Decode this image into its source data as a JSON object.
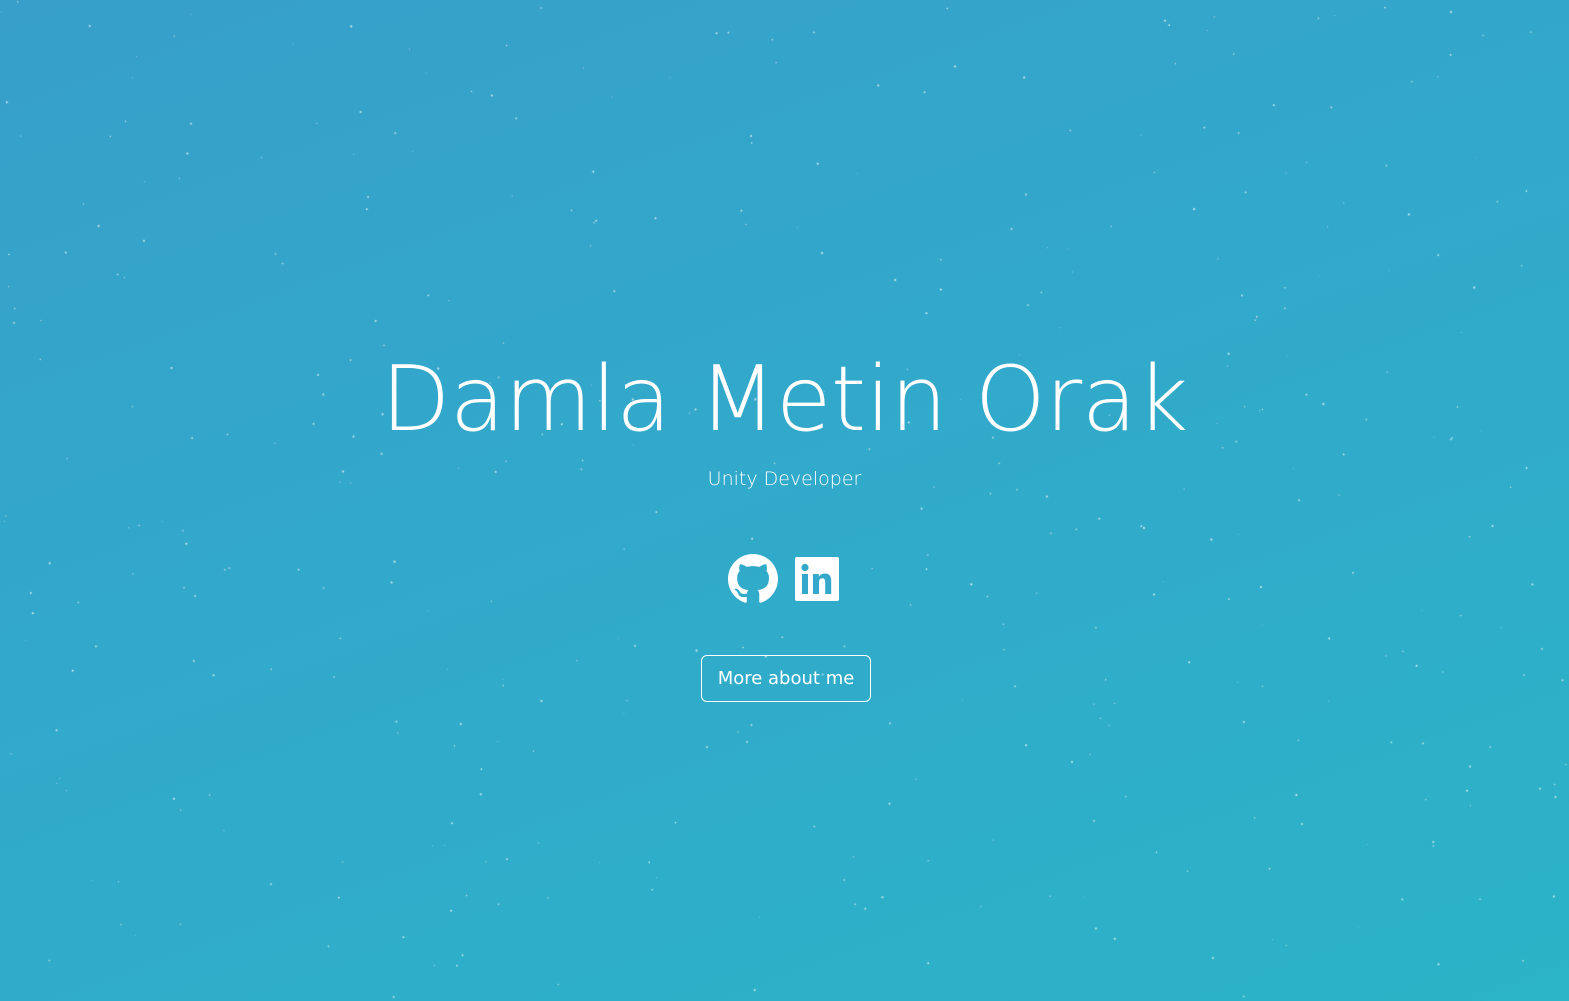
{
  "hero": {
    "name": "Damla Metin Orak",
    "role": "Unity Developer",
    "more_button": "More about me"
  },
  "social": [
    {
      "icon": "github-icon",
      "label": "GitHub"
    },
    {
      "icon": "linkedin-icon",
      "label": "LinkedIn"
    }
  ],
  "colors": {
    "background_start": "#379fca",
    "background_end": "#2bb3c7",
    "text": "#ffffff"
  }
}
